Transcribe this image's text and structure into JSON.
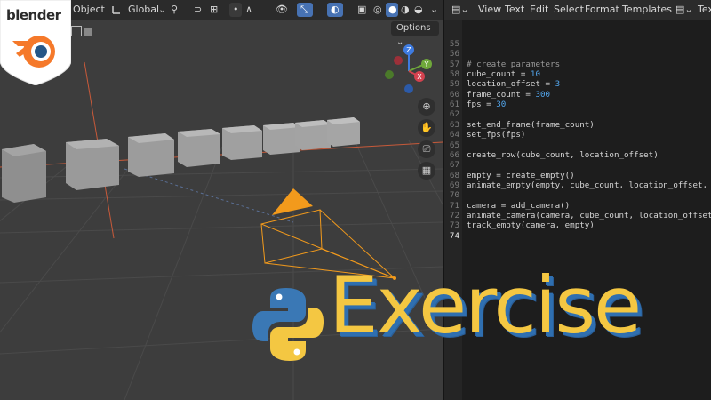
{
  "brand": {
    "logo_text": "blender"
  },
  "viewport": {
    "header": {
      "object_menu": "Object",
      "orientation": "Global",
      "options_label": "Options"
    },
    "gizmo": {
      "x": "X",
      "y": "Y",
      "z": "Z"
    }
  },
  "text_editor": {
    "menu": [
      "View",
      "Text",
      "Edit",
      "Select",
      "Format",
      "Templates"
    ],
    "tab_label": "Tex",
    "lines": [
      {
        "num": "55",
        "code": ""
      },
      {
        "num": "56",
        "code": ""
      },
      {
        "num": "57",
        "code": "# create parameters",
        "kind": "comment"
      },
      {
        "num": "58",
        "code": "cube_count = 10"
      },
      {
        "num": "59",
        "code": "location_offset = 3"
      },
      {
        "num": "60",
        "code": "frame_count = 300"
      },
      {
        "num": "61",
        "code": "fps = 30"
      },
      {
        "num": "62",
        "code": ""
      },
      {
        "num": "63",
        "code": "set_end_frame(frame_count)"
      },
      {
        "num": "64",
        "code": "set_fps(fps)"
      },
      {
        "num": "65",
        "code": ""
      },
      {
        "num": "66",
        "code": "create_row(cube_count, location_offset)"
      },
      {
        "num": "67",
        "code": ""
      },
      {
        "num": "68",
        "code": "empty = create_empty()"
      },
      {
        "num": "69",
        "code": "animate_empty(empty, cube_count, location_offset, fr"
      },
      {
        "num": "70",
        "code": ""
      },
      {
        "num": "71",
        "code": "camera = add_camera()"
      },
      {
        "num": "72",
        "code": "animate_camera(camera, cube_count, location_offset,"
      },
      {
        "num": "73",
        "code": "track_empty(camera, empty)"
      },
      {
        "num": "74",
        "code": ""
      }
    ],
    "current_line": "74"
  },
  "overlay": {
    "title": "Exercise"
  },
  "colors": {
    "accent_blue": "#4772b3",
    "number": "#53a8f0",
    "orange": "#f29a1c",
    "exercise_yellow": "#f4c742"
  }
}
